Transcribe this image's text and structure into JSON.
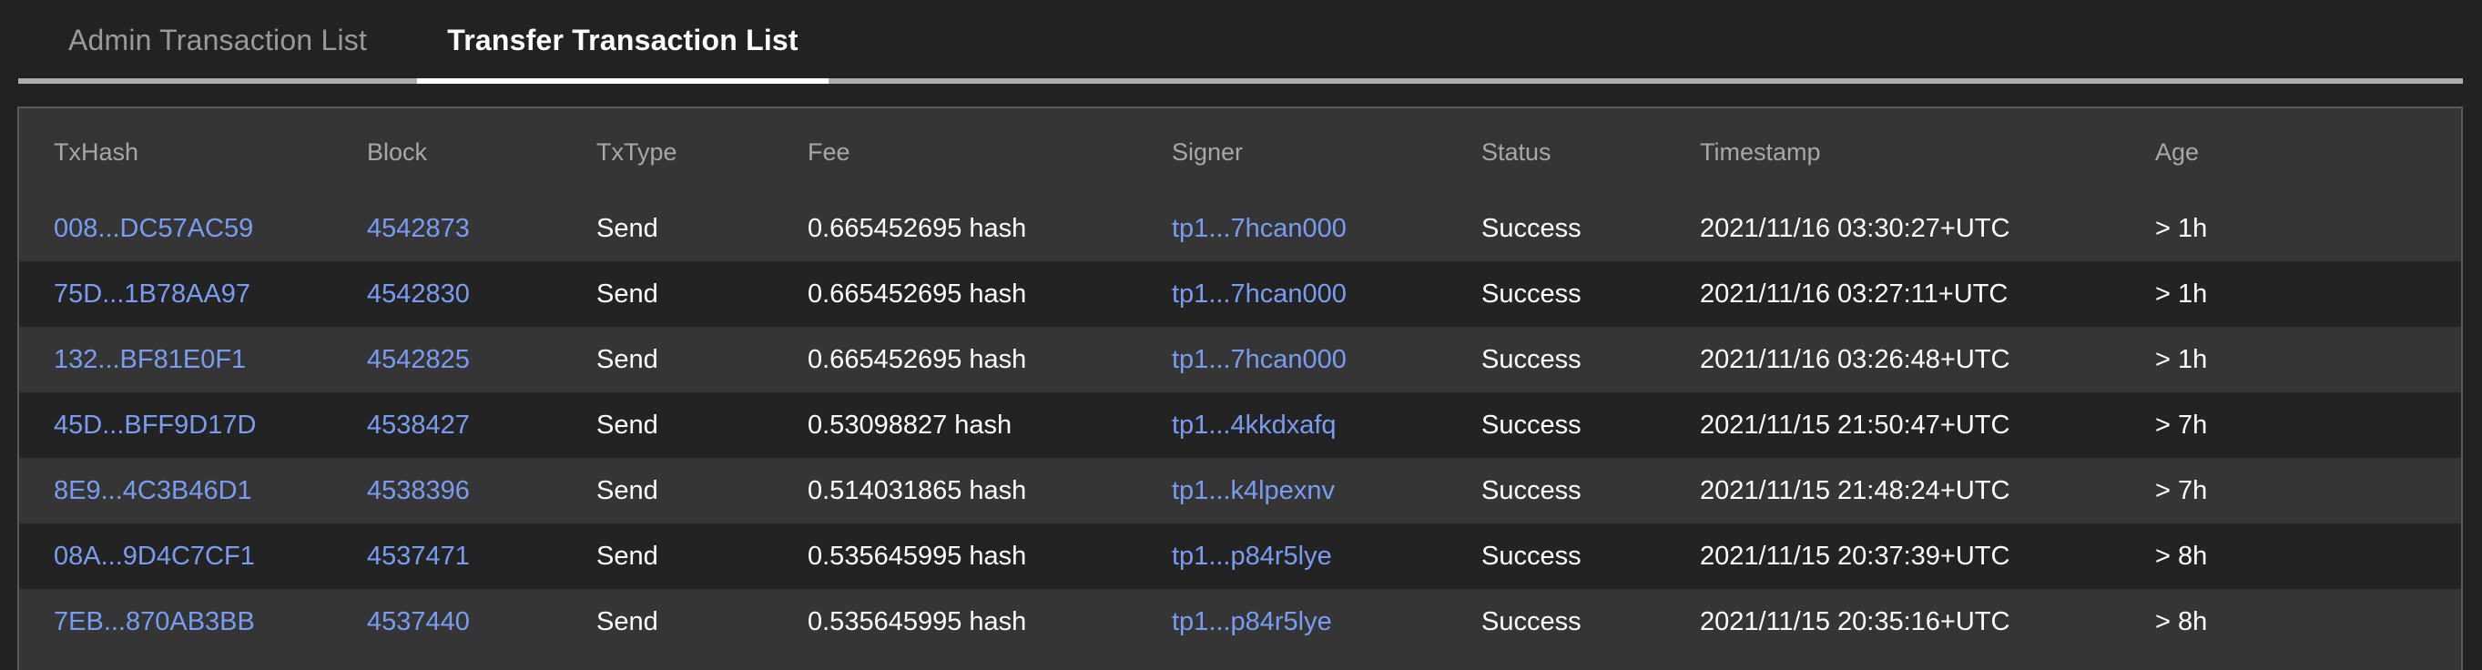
{
  "tabs": [
    {
      "label": "Admin Transaction List",
      "active": false
    },
    {
      "label": "Transfer Transaction List",
      "active": true
    }
  ],
  "table": {
    "columns": [
      "TxHash",
      "Block",
      "TxType",
      "Fee",
      "Signer",
      "Status",
      "Timestamp",
      "Age"
    ],
    "rows": [
      {
        "txhash": "008...DC57AC59",
        "block": "4542873",
        "txtype": "Send",
        "fee": "0.665452695 hash",
        "signer": "tp1...7hcan000",
        "status": "Success",
        "timestamp": "2021/11/16 03:30:27+UTC",
        "age": "> 1h"
      },
      {
        "txhash": "75D...1B78AA97",
        "block": "4542830",
        "txtype": "Send",
        "fee": "0.665452695 hash",
        "signer": "tp1...7hcan000",
        "status": "Success",
        "timestamp": "2021/11/16 03:27:11+UTC",
        "age": "> 1h"
      },
      {
        "txhash": "132...BF81E0F1",
        "block": "4542825",
        "txtype": "Send",
        "fee": "0.665452695 hash",
        "signer": "tp1...7hcan000",
        "status": "Success",
        "timestamp": "2021/11/16 03:26:48+UTC",
        "age": "> 1h"
      },
      {
        "txhash": "45D...BFF9D17D",
        "block": "4538427",
        "txtype": "Send",
        "fee": "0.53098827 hash",
        "signer": "tp1...4kkdxafq",
        "status": "Success",
        "timestamp": "2021/11/15 21:50:47+UTC",
        "age": "> 7h"
      },
      {
        "txhash": "8E9...4C3B46D1",
        "block": "4538396",
        "txtype": "Send",
        "fee": "0.514031865 hash",
        "signer": "tp1...k4lpexnv",
        "status": "Success",
        "timestamp": "2021/11/15 21:48:24+UTC",
        "age": "> 7h"
      },
      {
        "txhash": "08A...9D4C7CF1",
        "block": "4537471",
        "txtype": "Send",
        "fee": "0.535645995 hash",
        "signer": "tp1...p84r5lye",
        "status": "Success",
        "timestamp": "2021/11/15 20:37:39+UTC",
        "age": "> 8h"
      },
      {
        "txhash": "7EB...870AB3BB",
        "block": "4537440",
        "txtype": "Send",
        "fee": "0.535645995 hash",
        "signer": "tp1...p84r5lye",
        "status": "Success",
        "timestamp": "2021/11/15 20:35:16+UTC",
        "age": "> 8h"
      }
    ]
  },
  "colors": {
    "background": "#222222",
    "card_background": "#353535",
    "row_alt_background": "#232323",
    "link": "#7a9cf0",
    "header_text": "#a7a7a7",
    "active_tab_text": "#ffffff",
    "inactive_tab_text": "#9a9a9a",
    "underline": "#adadad",
    "active_underline": "#ffffff",
    "border": "#5a5a5a"
  }
}
